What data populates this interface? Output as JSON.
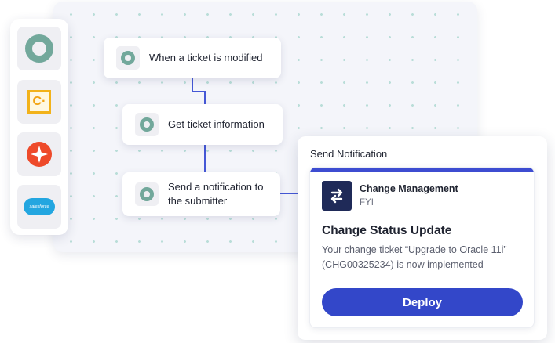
{
  "sidebar": {
    "items": [
      {
        "name": "workflow-app",
        "icon": "ring-logo-icon"
      },
      {
        "name": "c-app",
        "icon": "c-logo-icon",
        "letter": "C·"
      },
      {
        "name": "star-app",
        "icon": "star-logo-icon"
      },
      {
        "name": "salesforce",
        "icon": "salesforce-logo-icon",
        "logo_text": "salesforce"
      }
    ]
  },
  "workflow": {
    "steps": [
      {
        "label": "When a ticket is modified"
      },
      {
        "label": "Get ticket information"
      },
      {
        "label": "Send a notification to the submitter"
      }
    ]
  },
  "notification": {
    "panel_title": "Send Notification",
    "app_name": "Change Management",
    "app_subtitle": "FYI",
    "message_title": "Change Status Update",
    "message_body": "Your change ticket “Upgrade to Oracle 11i” (CHG00325234) is now implemented",
    "deploy_label": "Deploy"
  },
  "colors": {
    "accent": "#3347c9",
    "connector": "#4558d6",
    "logo_green": "#72a89b",
    "app_icon_bg": "#1f2a58"
  }
}
